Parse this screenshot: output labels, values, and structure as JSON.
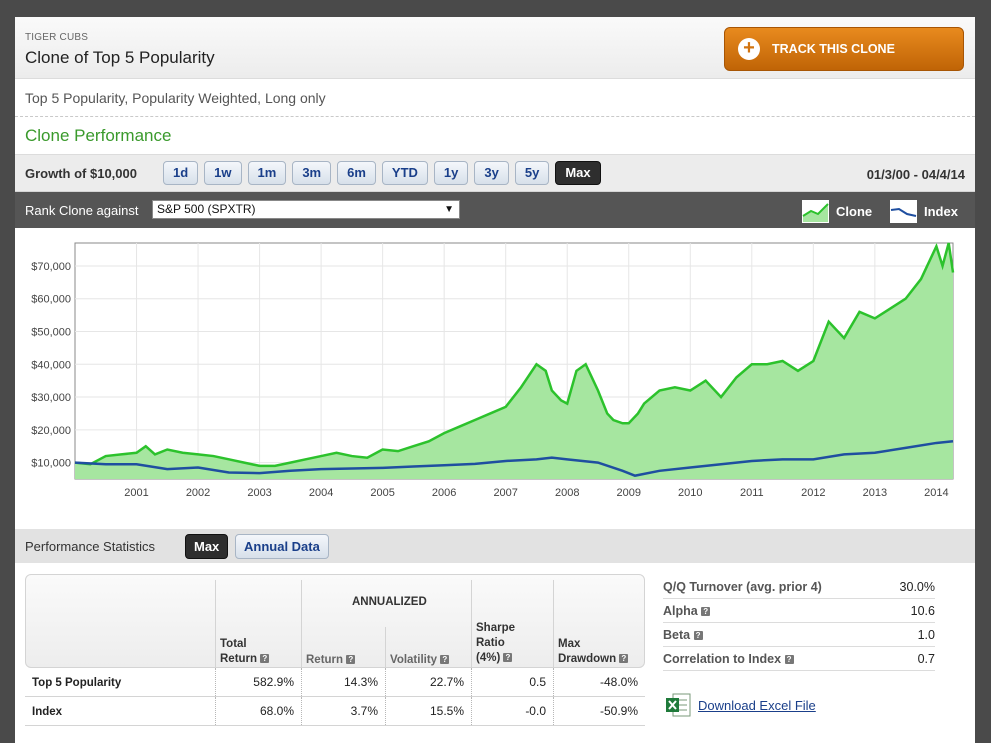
{
  "header": {
    "kicker": "TIGER CUBS",
    "title": "Clone of Top 5 Popularity",
    "track_button": "TRACK THIS CLONE"
  },
  "subtitle": "Top 5 Popularity, Popularity Weighted, Long only",
  "section_title": "Clone Performance",
  "growth": {
    "label": "Growth of $10,000",
    "ranges": [
      "1d",
      "1w",
      "1m",
      "3m",
      "6m",
      "YTD",
      "1y",
      "3y",
      "5y",
      "Max"
    ],
    "active_range": "Max",
    "date_range": "01/3/00 - 04/4/14"
  },
  "rank": {
    "label": "Rank Clone against",
    "selected": "S&P 500 (SPXTR)",
    "legend_clone": "Clone",
    "legend_index": "Index"
  },
  "chart_data": {
    "type": "area",
    "x_ticks": [
      "2001",
      "2002",
      "2003",
      "2004",
      "2005",
      "2006",
      "2007",
      "2008",
      "2009",
      "2010",
      "2011",
      "2012",
      "2013",
      "2014"
    ],
    "y_ticks": [
      "$10,000",
      "$20,000",
      "$30,000",
      "$40,000",
      "$50,000",
      "$60,000",
      "$70,000"
    ],
    "xlim": [
      2000.0,
      2014.27
    ],
    "ylim": [
      5000,
      77000
    ],
    "grid": true,
    "colors": {
      "clone_fill": "#a6e6a0",
      "clone_line": "#2cc22c",
      "index_line": "#1f4fa0"
    },
    "series": [
      {
        "name": "Clone",
        "x": [
          2000.0,
          2000.25,
          2000.5,
          2000.75,
          2001.0,
          2001.15,
          2001.3,
          2001.5,
          2001.75,
          2002.0,
          2002.25,
          2002.5,
          2002.75,
          2003.0,
          2003.25,
          2003.5,
          2003.75,
          2004.0,
          2004.25,
          2004.5,
          2004.75,
          2005.0,
          2005.25,
          2005.5,
          2005.75,
          2006.0,
          2006.25,
          2006.5,
          2006.75,
          2007.0,
          2007.25,
          2007.5,
          2007.65,
          2007.75,
          2007.9,
          2008.0,
          2008.15,
          2008.3,
          2008.5,
          2008.65,
          2008.75,
          2008.9,
          2009.0,
          2009.15,
          2009.25,
          2009.5,
          2009.75,
          2010.0,
          2010.25,
          2010.5,
          2010.75,
          2011.0,
          2011.25,
          2011.5,
          2011.75,
          2012.0,
          2012.25,
          2012.5,
          2012.75,
          2013.0,
          2013.25,
          2013.5,
          2013.75,
          2013.85,
          2014.0,
          2014.1,
          2014.2,
          2014.27
        ],
        "y": [
          10000,
          9500,
          12000,
          12500,
          13000,
          15000,
          12500,
          14000,
          13000,
          12500,
          12000,
          11000,
          10000,
          9000,
          9000,
          10000,
          11000,
          12000,
          13000,
          12000,
          11500,
          14000,
          13500,
          15000,
          16500,
          19000,
          21000,
          23000,
          25000,
          27000,
          33000,
          40000,
          38000,
          32000,
          29000,
          28000,
          38000,
          40000,
          32000,
          25000,
          23000,
          22000,
          22000,
          25000,
          28000,
          32000,
          33000,
          32000,
          35000,
          30000,
          36000,
          40000,
          40000,
          41000,
          38000,
          41000,
          53000,
          48000,
          56000,
          54000,
          57000,
          60000,
          66000,
          70000,
          76000,
          70000,
          77000,
          68000
        ]
      },
      {
        "name": "Index",
        "x": [
          2000.0,
          2000.5,
          2001.0,
          2001.5,
          2002.0,
          2002.5,
          2003.0,
          2003.5,
          2004.0,
          2004.5,
          2005.0,
          2005.5,
          2006.0,
          2006.5,
          2007.0,
          2007.5,
          2007.75,
          2008.0,
          2008.5,
          2008.9,
          2009.1,
          2009.5,
          2010.0,
          2010.5,
          2011.0,
          2011.5,
          2012.0,
          2012.5,
          2013.0,
          2013.5,
          2014.0,
          2014.27
        ],
        "y": [
          10000,
          9500,
          9500,
          8000,
          8500,
          7000,
          6800,
          7500,
          8000,
          8200,
          8400,
          8800,
          9200,
          9600,
          10500,
          11000,
          11500,
          11000,
          10000,
          7500,
          6000,
          7500,
          8500,
          9500,
          10500,
          11000,
          11000,
          12500,
          13000,
          14500,
          16000,
          16500
        ]
      }
    ]
  },
  "stats": {
    "label": "Performance Statistics",
    "btn_max": "Max",
    "btn_annual": "Annual Data",
    "annualized": "ANNUALIZED",
    "headers": {
      "total_return": "Total\nReturn",
      "return": "Return",
      "volatility": "Volatility",
      "sharpe": "Sharpe\nRatio\n(4%)",
      "max_drawdown": "Max\nDrawdown"
    },
    "rows": [
      {
        "name": "Top 5 Popularity",
        "total_return": "582.9%",
        "return": "14.3%",
        "volatility": "22.7%",
        "sharpe": "0.5",
        "max_drawdown": "-48.0%"
      },
      {
        "name": "Index",
        "total_return": "68.0%",
        "return": "3.7%",
        "volatility": "15.5%",
        "sharpe": "-0.0",
        "max_drawdown": "-50.9%"
      }
    ],
    "side": [
      {
        "label": "Q/Q Turnover (avg. prior 4)",
        "value": "30.0%"
      },
      {
        "label": "Alpha",
        "value": "10.6"
      },
      {
        "label": "Beta",
        "value": "1.0"
      },
      {
        "label": "Correlation to Index",
        "value": "0.7"
      }
    ],
    "download": "Download Excel File",
    "help_glyph": "?"
  }
}
